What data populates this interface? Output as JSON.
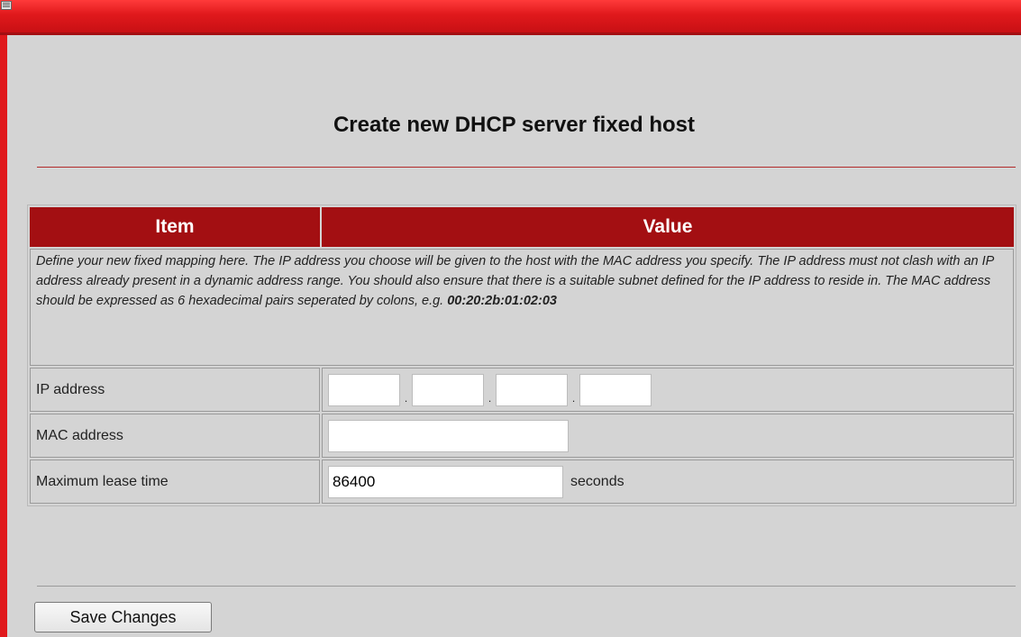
{
  "page": {
    "title": "Create new DHCP server fixed host"
  },
  "table": {
    "headers": [
      "Item",
      "Value"
    ],
    "description_text": "Define your new fixed mapping here. The IP address you choose will be given to the host with the MAC address you specify. The IP address must not clash with an IP address already present in a dynamic address range. You should also ensure that there is a suitable subnet defined for the IP address to reside in. The MAC address should be expressed as 6 hexadecimal pairs seperated by colons, e.g. ",
    "description_example": "00:20:2b:01:02:03",
    "rows": {
      "ip": {
        "label": "IP address",
        "octets": [
          "",
          "",
          "",
          ""
        ],
        "separator": "."
      },
      "mac": {
        "label": "MAC address",
        "value": ""
      },
      "lease": {
        "label": "Maximum lease time",
        "value": "86400",
        "unit": "seconds"
      }
    }
  },
  "actions": {
    "save_label": "Save Changes"
  },
  "colors": {
    "frame_red": "#e0191c",
    "header_red": "#a30f12",
    "background": "#d4d4d4"
  }
}
